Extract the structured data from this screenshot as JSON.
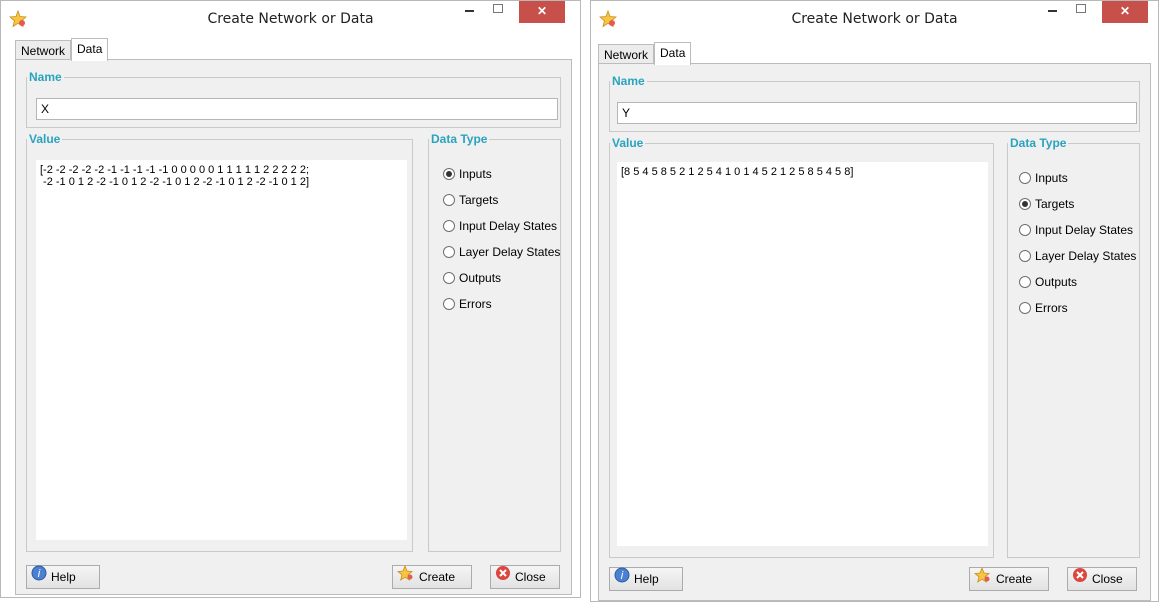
{
  "windows": [
    {
      "title": "Create Network or Data",
      "tabs": [
        "Network",
        "Data"
      ],
      "active_tab": "Data",
      "name_label": "Name",
      "name_value": "X",
      "value_label": "Value",
      "value_text": "[-2 -2 -2 -2 -2 -1 -1 -1 -1 -1 0 0 0 0 0 1 1 1 1 1 2 2 2 2 2;\n -2 -1 0 1 2 -2 -1 0 1 2 -2 -1 0 1 2 -2 -1 0 1 2 -2 -1 0 1 2]",
      "data_type_label": "Data Type",
      "data_types": [
        "Inputs",
        "Targets",
        "Input Delay States",
        "Layer Delay States",
        "Outputs",
        "Errors"
      ],
      "selected_data_type": "Inputs",
      "help_label": "Help",
      "create_label": "Create",
      "close_label": "Close"
    },
    {
      "title": "Create Network or Data",
      "tabs": [
        "Network",
        "Data"
      ],
      "active_tab": "Data",
      "name_label": "Name",
      "name_value": "Y",
      "value_label": "Value",
      "value_text": "[8 5 4 5 8 5 2 1 2 5 4 1 0 1 4 5 2 1 2 5 8 5 4 5 8]",
      "data_type_label": "Data Type",
      "data_types": [
        "Inputs",
        "Targets",
        "Input Delay States",
        "Layer Delay States",
        "Outputs",
        "Errors"
      ],
      "selected_data_type": "Targets",
      "help_label": "Help",
      "create_label": "Create",
      "close_label": "Close"
    }
  ],
  "icons": {
    "app": "star-icon",
    "help": "help-icon",
    "create": "star-icon",
    "close": "close-circle-icon"
  },
  "colors": {
    "legend": "#2aa3bf",
    "close_button": "#c7504a",
    "panel": "#f0f0f0"
  }
}
